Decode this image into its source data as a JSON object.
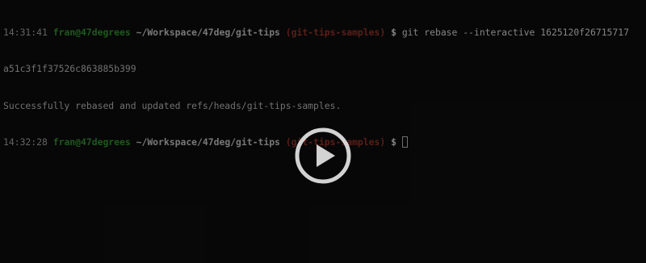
{
  "terminal": {
    "lines": [
      {
        "time": "14:31:41",
        "user": "fran@47degrees",
        "path": "~/Workspace/47deg/git-tips",
        "branch": "(git-tips-samples)",
        "prompt": "$",
        "command": "git rebase --interactive 1625120f26715717"
      },
      {
        "output": "a51c3f1f37526c863885b399"
      },
      {
        "output": "Successfully rebased and updated refs/heads/git-tips-samples."
      },
      {
        "time": "14:32:28",
        "user": "fran@47degrees",
        "path": "~/Workspace/47deg/git-tips",
        "branch": "(git-tips-samples)",
        "prompt": "$",
        "command": ""
      }
    ]
  },
  "video": {
    "play_icon": "play-icon",
    "icon_color": "#ffffff"
  },
  "colors": {
    "background": "#0b0b0b",
    "user": "#2b7a2b",
    "branch": "#7e2a22"
  }
}
